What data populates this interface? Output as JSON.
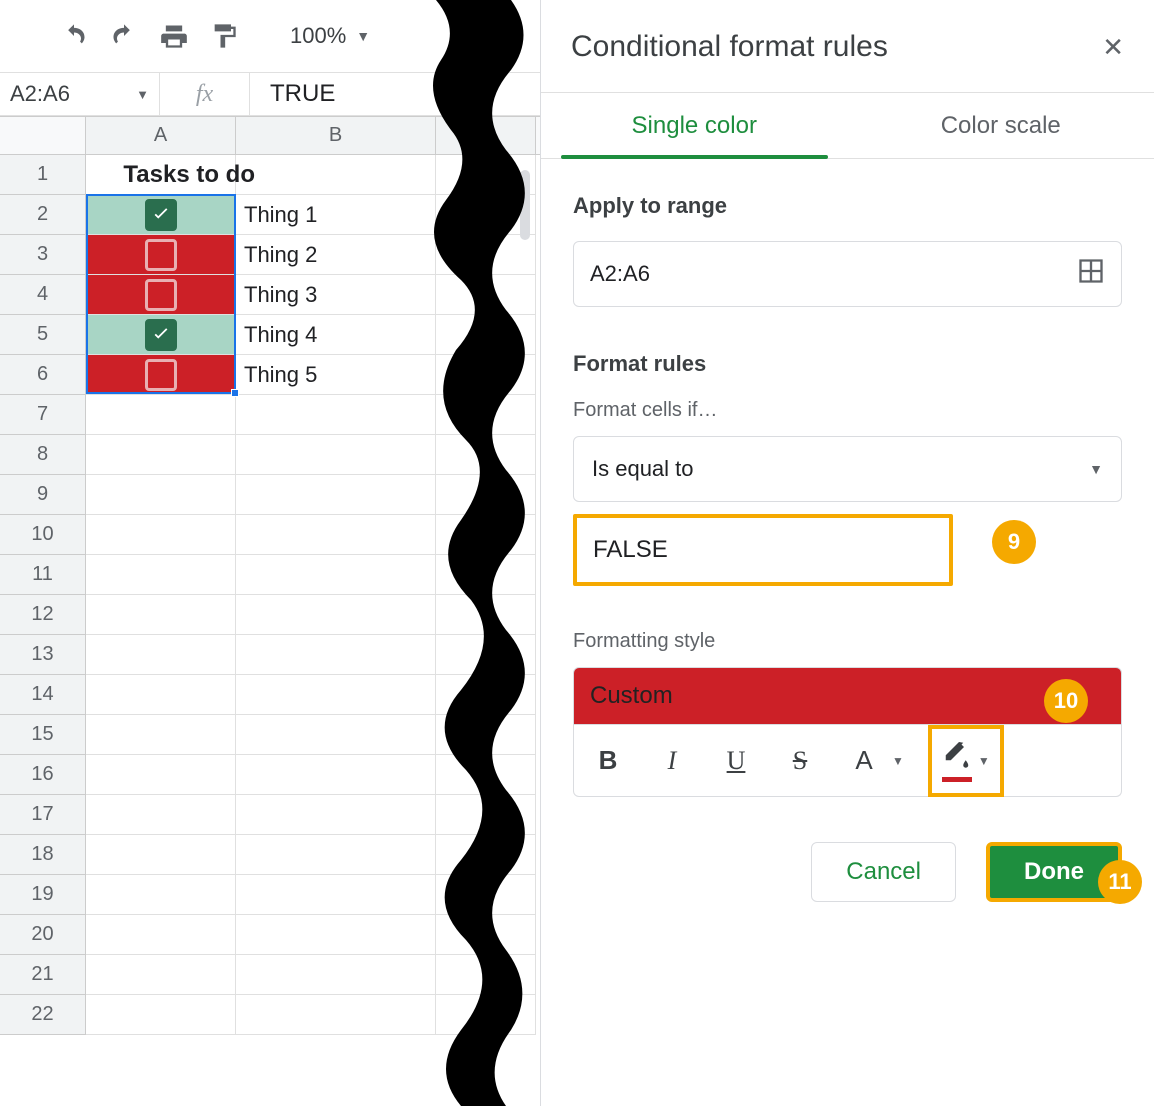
{
  "toolbar": {
    "zoom_level": "100%"
  },
  "namebox": {
    "reference": "A2:A6",
    "formula_value": "TRUE",
    "fx_label": "fx"
  },
  "columns": [
    "A",
    "B"
  ],
  "row_header_count": 22,
  "sheet": {
    "title_cell": "Tasks to do",
    "rows": [
      {
        "row": 2,
        "checked": true,
        "bgcolor": "green",
        "label": "Thing 1"
      },
      {
        "row": 3,
        "checked": false,
        "bgcolor": "red",
        "label": "Thing 2"
      },
      {
        "row": 4,
        "checked": false,
        "bgcolor": "red",
        "label": "Thing 3"
      },
      {
        "row": 5,
        "checked": true,
        "bgcolor": "green",
        "label": "Thing 4"
      },
      {
        "row": 6,
        "checked": false,
        "bgcolor": "red",
        "label": "Thing 5"
      }
    ]
  },
  "panel": {
    "title": "Conditional format rules",
    "tab_single": "Single color",
    "tab_scale": "Color scale",
    "apply_range_label": "Apply to range",
    "apply_range_value": "A2:A6",
    "format_rules_label": "Format rules",
    "format_cells_label": "Format cells if…",
    "condition_dropdown": "Is equal to",
    "condition_value": "FALSE",
    "formatting_style_label": "Formatting style",
    "style_name": "Custom",
    "cancel_label": "Cancel",
    "done_label": "Done"
  },
  "annotations": {
    "badge9": "9",
    "badge10": "10",
    "badge11": "11"
  },
  "colors": {
    "red": "#cc2027",
    "teal": "#a8d5c5",
    "green": "#1e8e3e",
    "amber": "#f5a900"
  }
}
